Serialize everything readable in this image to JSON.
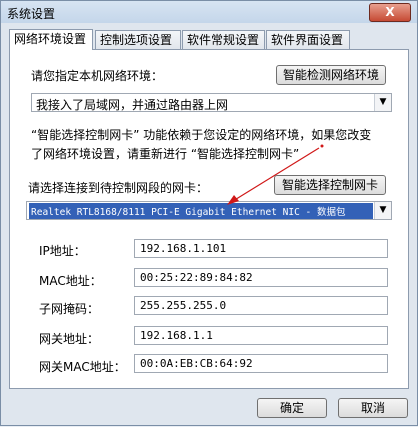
{
  "window": {
    "title": "系统设置",
    "close_label": "X"
  },
  "tabs": [
    {
      "label": "网络环境设置",
      "active": true
    },
    {
      "label": "控制选项设置",
      "active": false
    },
    {
      "label": "软件常规设置",
      "active": false
    },
    {
      "label": "软件界面设置",
      "active": false
    }
  ],
  "network": {
    "env_prompt": "请您指定本机网络环境：",
    "auto_detect_button": "智能检测网络环境",
    "env_selected": "我接入了局域网，并通过路由器上网",
    "note_line1": "“智能选择控制网卡” 功能依赖于您设定的网络环境，如果您改变",
    "note_line2": "了网络环境设置，请重新进行 “智能选择控制网卡”",
    "nic_prompt": "请选择连接到待控制网段的网卡：",
    "smart_nic_button": "智能选择控制网卡",
    "nic_selected": "Realtek RTL8168/8111 PCI-E Gigabit Ethernet NIC - 数据包"
  },
  "fields": {
    "ip_label": "IP地址：",
    "ip_value": "192.168.1.101",
    "mac_label": "MAC地址：",
    "mac_value": "00:25:22:89:84:82",
    "mask_label": "子网掩码：",
    "mask_value": "255.255.255.0",
    "gateway_label": "网关地址：",
    "gateway_value": "192.168.1.1",
    "gateway_mac_label": "网关MAC地址：",
    "gateway_mac_value": "00:0A:EB:CB:64:92"
  },
  "footer": {
    "ok_label": "确定",
    "cancel_label": "取消"
  },
  "colors": {
    "selection": "#3361b7",
    "annotation_arrow": "#d01818"
  }
}
